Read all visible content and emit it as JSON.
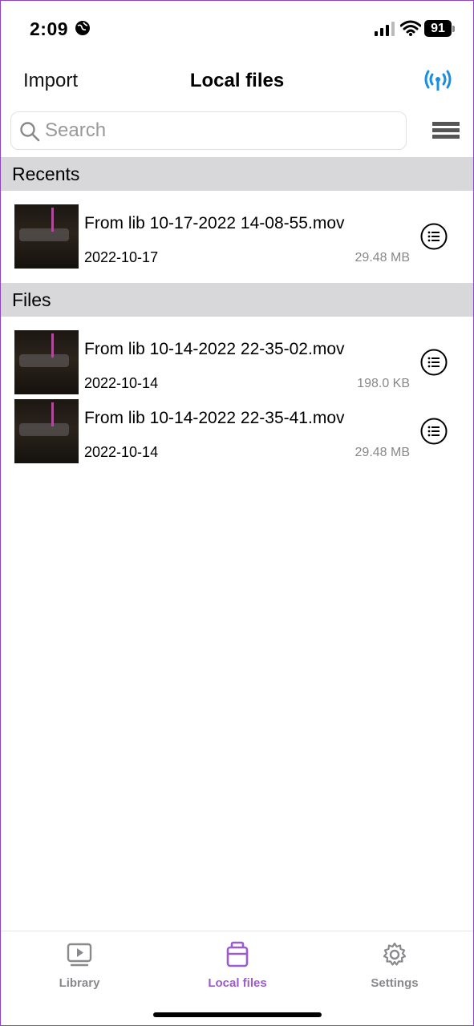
{
  "status_bar": {
    "time": "2:09",
    "battery": "91"
  },
  "nav": {
    "import_label": "Import",
    "title": "Local files",
    "broadcast_icon": "broadcast-icon"
  },
  "search": {
    "placeholder": "Search",
    "value": ""
  },
  "sections": {
    "recents": {
      "title": "Recents",
      "items": [
        {
          "name": "From lib 10-17-2022 14-08-55.mov",
          "date": "2022-10-17",
          "size": "29.48 MB"
        }
      ]
    },
    "files": {
      "title": "Files",
      "items": [
        {
          "name": "From lib 10-14-2022 22-35-02.mov",
          "date": "2022-10-14",
          "size": "198.0 KB"
        },
        {
          "name": "From lib 10-14-2022 22-35-41.mov",
          "date": "2022-10-14",
          "size": "29.48 MB"
        }
      ]
    }
  },
  "tabs": [
    {
      "label": "Library",
      "icon": "library-icon",
      "active": false
    },
    {
      "label": "Local files",
      "icon": "local-files-icon",
      "active": true
    },
    {
      "label": "Settings",
      "icon": "gear-icon",
      "active": false
    }
  ],
  "colors": {
    "accent": "#9a5ccf",
    "broadcast": "#1a8fe0",
    "section_bg": "#d8d8da",
    "frame_border": "#8e44c8"
  }
}
